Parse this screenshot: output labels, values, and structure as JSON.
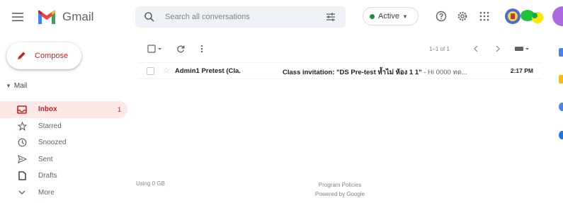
{
  "app": {
    "name": "Gmail"
  },
  "search": {
    "placeholder": "Search all conversations"
  },
  "status": {
    "label": "Active"
  },
  "compose": {
    "label": "Compose"
  },
  "mail_section": {
    "label": "Mail"
  },
  "nav": {
    "items": [
      {
        "label": "Inbox",
        "count": "1",
        "icon": "inbox-icon",
        "active": true
      },
      {
        "label": "Starred",
        "icon": "star-icon"
      },
      {
        "label": "Snoozed",
        "icon": "clock-icon"
      },
      {
        "label": "Sent",
        "icon": "send-icon"
      },
      {
        "label": "Drafts",
        "icon": "draft-icon"
      },
      {
        "label": "More",
        "icon": "chevron-down-icon"
      }
    ]
  },
  "toolbar": {
    "pager": "1–1 of 1"
  },
  "emails": [
    {
      "sender": "Admin1 Pretest (Cla.",
      "subject": "Class invitation: \"DS Pre-test ห้ำไม่ ห้อง 1 1\"",
      "snippet": " - Hi 0000 ทด...",
      "time": "2:17 PM"
    }
  ],
  "footer": {
    "storage": "Using 0 GB",
    "policies": "Program Policies",
    "powered": "Powered by Google"
  },
  "colors": {
    "accent_red": "#c5221f",
    "active_bg": "#fce8e6",
    "status_green": "#1e8e3e",
    "search_bg": "#eef1f5"
  }
}
